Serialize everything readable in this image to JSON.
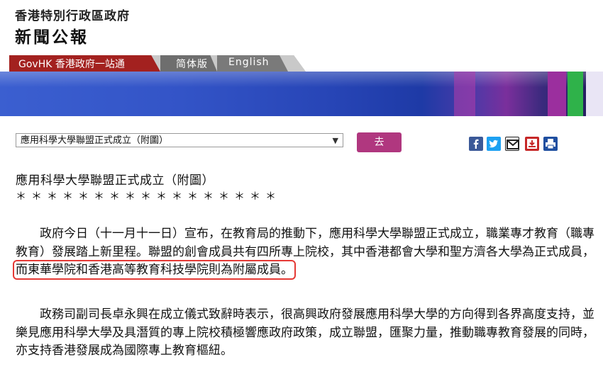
{
  "header": {
    "line1": "香港特別行政區政府",
    "line2": "新聞公報"
  },
  "nav": {
    "govhk": "GovHK 香港政府一站通",
    "simplified": "简体版",
    "english": "English"
  },
  "selector": {
    "selected": "應用科學大學聯盟正式成立（附圖）",
    "go_label": "去"
  },
  "share_icons": [
    "facebook-icon",
    "twitter-icon",
    "email-icon",
    "download-icon",
    "print-icon"
  ],
  "colors": {
    "govhk_red": "#a3211f",
    "go_button": "#b0377f",
    "highlight": "#e53935"
  },
  "article": {
    "title": "應用科學大學聯盟正式成立（附圖）",
    "stars": "＊＊＊＊＊＊＊＊＊＊＊＊＊＊＊＊＊",
    "para1_a": "　　政府今日（十一月十一日）宣布，在教育局的推動下，應用科學大學聯盟正式成立，職業專才教育（職專教育）發展踏上新里程。聯盟的創會成員共有四所專上院校，其中香港都會大學和聖方濟各大學為正式成員，",
    "para1_highlight": "而東華學院和香港高等教育科技學院則為附屬成員。",
    "para2": "　　政務司副司長卓永興在成立儀式致辭時表示，很高興政府發展應用科學大學的方向得到各界高度支持，並樂見應用科學大學及具潛質的專上院校積極響應政府政策，成立聯盟，匯聚力量，推動職專教育發展的同時，亦支持香港發展成為國際專上教育樞紐。"
  }
}
